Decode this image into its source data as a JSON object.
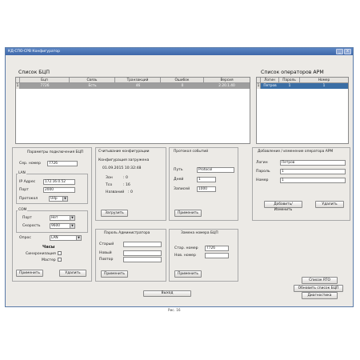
{
  "window": {
    "title": "КД-СПО-СРВ Конфигуратор",
    "btn_min": "_",
    "btn_close": "x"
  },
  "bcp_list": {
    "title": "Список БЦП",
    "columns": [
      "",
      "Бцп",
      "Связь",
      "Транзакций",
      "Ошибок",
      "Версия"
    ],
    "row": {
      "marker": "1",
      "bcp": "7726",
      "link": "Есть",
      "transactions": "46",
      "errors": "0",
      "version": "2.20.1.40"
    }
  },
  "operators_list": {
    "title": "Список операторов АРМ",
    "columns": [
      "",
      "Логин",
      "Пароль",
      "Номер"
    ],
    "row": {
      "marker": "1",
      "login": "Петров",
      "password": "1",
      "number": "1"
    }
  },
  "conn_params": {
    "title": "Параметры подключения БЦП",
    "serial_label": "Сер. номер",
    "serial_value": "7726",
    "lan_label": "LAN",
    "ip_label": "IP Адрес",
    "ip_value": "172.16.0.52",
    "port_label": "Порт",
    "port_value": "2000",
    "protocol_label": "Протокол",
    "protocol_value": "Udp",
    "com_label": "COM",
    "com_port_label": "Порт",
    "com_port_value": "Нет",
    "speed_label": "Скорость",
    "speed_value": "9600",
    "poll_label": "Опрос",
    "poll_value": "LAN",
    "clock_label": "Часы",
    "sync_label": "Синхронизация",
    "master_label": "Мастер",
    "apply_btn": "Применить",
    "delete_btn": "Удалить"
  },
  "config_read": {
    "title": "Считывание конфигурации",
    "status": "Конфигурация загружена",
    "datetime": "01.09.2015 10:32:48",
    "zones_label": "Зон",
    "zones_value": ": 0",
    "tcs_label": "Тсо",
    "tcs_value": ": 16",
    "names_label": "Названий",
    "names_value": ": 0",
    "load_btn": "Загрузить"
  },
  "events": {
    "title": "Протокол событий",
    "path_label": "Путь",
    "path_value": "Protocol",
    "days_label": "Дней",
    "days_value": "1",
    "records_label": "Записей",
    "records_value": "1000",
    "apply_btn": "Применить"
  },
  "operator_edit": {
    "title": "Добавление / изменение оператора АРМ",
    "login_label": "Логин",
    "login_value": "Петров",
    "password_label": "Пароль",
    "password_value": "1",
    "number_label": "Номер",
    "number_value": "1",
    "add_btn": "Добавить/Изменить",
    "delete_btn": "Удалить"
  },
  "admin_pass": {
    "title": "Пароль Администратора",
    "old_label": "Старый",
    "new_label": "Новый",
    "repeat_label": "Повтор",
    "apply_btn": "Применить"
  },
  "bcp_number": {
    "title": "Замена номера БЦП",
    "old_label": "Стар. номер",
    "old_value": "7726",
    "new_label": "Нов. номер",
    "apply_btn": "Применить"
  },
  "side_buttons": {
    "rto_list": "Список RTO",
    "refresh": "Обновить список БЦП",
    "diag": "Диагностика"
  },
  "exit_btn": "Выход",
  "caption": "Рис. 16"
}
